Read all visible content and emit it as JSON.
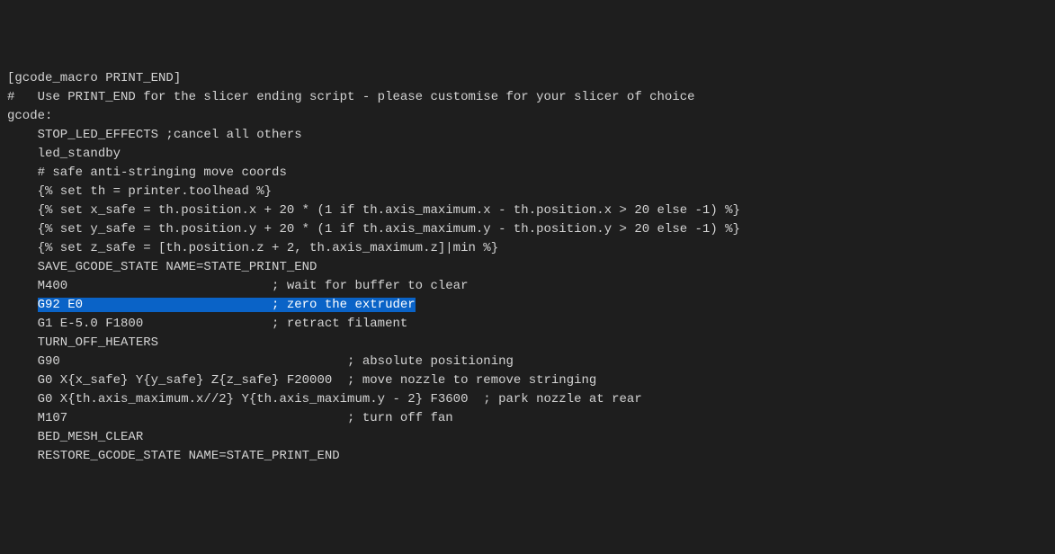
{
  "lines": [
    {
      "text": "[gcode_macro PRINT_END]",
      "indent": 0,
      "highlight": false
    },
    {
      "text": "#   Use PRINT_END for the slicer ending script - please customise for your slicer of choice",
      "indent": 0,
      "highlight": false
    },
    {
      "text": "gcode:",
      "indent": 0,
      "highlight": false
    },
    {
      "text": "STOP_LED_EFFECTS ;cancel all others",
      "indent": 1,
      "highlight": false
    },
    {
      "text": "led_standby",
      "indent": 1,
      "highlight": false
    },
    {
      "text": "# safe anti-stringing move coords",
      "indent": 1,
      "highlight": false
    },
    {
      "text": "{% set th = printer.toolhead %}",
      "indent": 1,
      "highlight": false
    },
    {
      "text": "{% set x_safe = th.position.x + 20 * (1 if th.axis_maximum.x - th.position.x > 20 else -1) %}",
      "indent": 1,
      "highlight": false
    },
    {
      "text": "{% set y_safe = th.position.y + 20 * (1 if th.axis_maximum.y - th.position.y > 20 else -1) %}",
      "indent": 1,
      "highlight": false
    },
    {
      "text": "{% set z_safe = [th.position.z + 2, th.axis_maximum.z]|min %}",
      "indent": 1,
      "highlight": false
    },
    {
      "text": "SAVE_GCODE_STATE NAME=STATE_PRINT_END",
      "indent": 1,
      "highlight": false
    },
    {
      "text": "M400                           ; wait for buffer to clear",
      "indent": 1,
      "highlight": false
    },
    {
      "text": "G92 E0                         ; zero the extruder",
      "indent": 1,
      "highlight": true
    },
    {
      "text": "G1 E-5.0 F1800                 ; retract filament",
      "indent": 1,
      "highlight": false
    },
    {
      "text": "TURN_OFF_HEATERS",
      "indent": 1,
      "highlight": false
    },
    {
      "text": "G90                                      ; absolute positioning",
      "indent": 1,
      "highlight": false
    },
    {
      "text": "G0 X{x_safe} Y{y_safe} Z{z_safe} F20000  ; move nozzle to remove stringing",
      "indent": 1,
      "highlight": false
    },
    {
      "text": "G0 X{th.axis_maximum.x//2} Y{th.axis_maximum.y - 2} F3600  ; park nozzle at rear",
      "indent": 1,
      "highlight": false
    },
    {
      "text": "M107                                     ; turn off fan",
      "indent": 1,
      "highlight": false
    },
    {
      "text": "BED_MESH_CLEAR",
      "indent": 1,
      "highlight": false
    },
    {
      "text": "RESTORE_GCODE_STATE NAME=STATE_PRINT_END",
      "indent": 1,
      "highlight": false
    }
  ],
  "indentUnit": "    "
}
